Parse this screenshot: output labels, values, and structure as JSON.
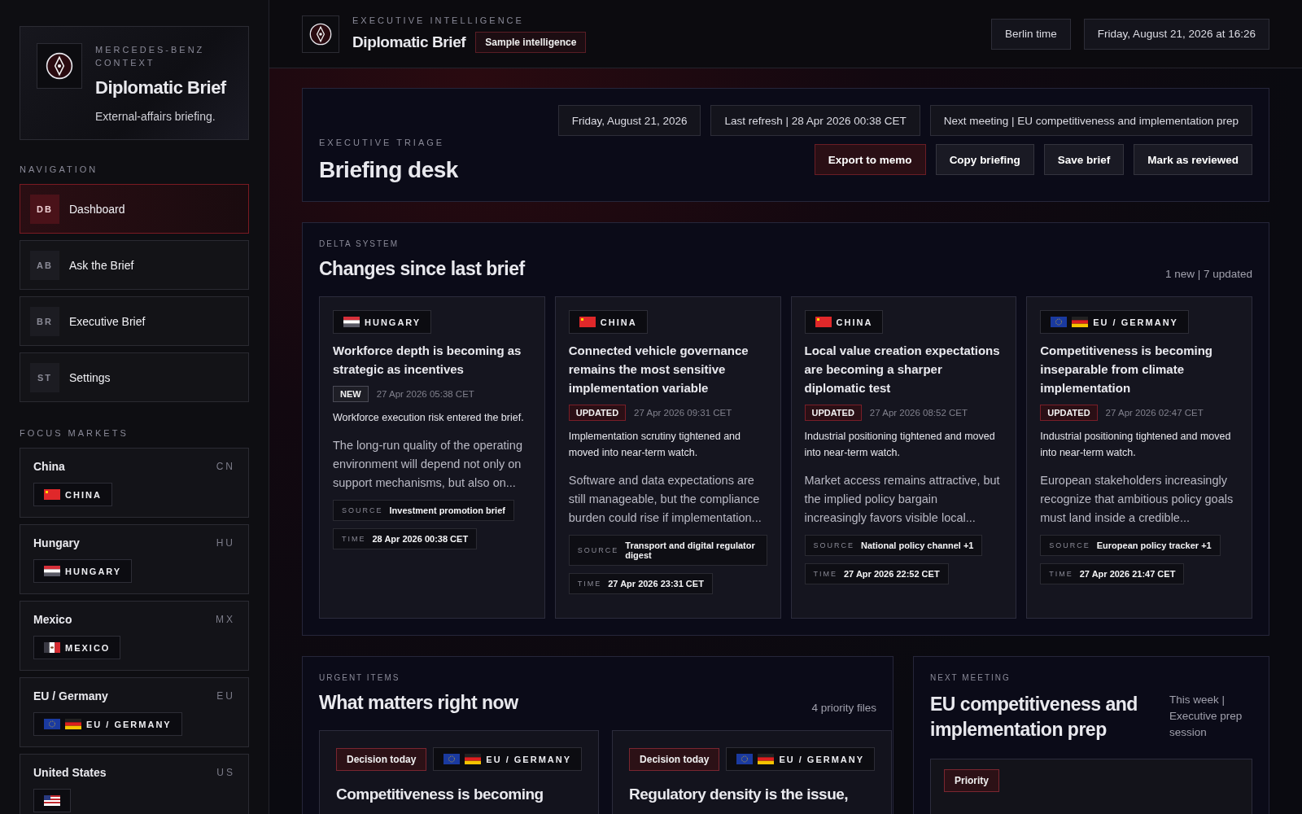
{
  "sidebar": {
    "brand": {
      "eyebrow": "MERCEDES-BENZ CONTEXT",
      "title": "Diplomatic Brief",
      "subtitle": "External-affairs briefing."
    },
    "navigation_label": "NAVIGATION",
    "nav_items": [
      {
        "code": "DB",
        "label": "Dashboard",
        "selected": true
      },
      {
        "code": "AB",
        "label": "Ask the Brief",
        "selected": false
      },
      {
        "code": "BR",
        "label": "Executive Brief",
        "selected": false
      },
      {
        "code": "ST",
        "label": "Settings",
        "selected": false
      }
    ],
    "markets_label": "FOCUS MARKETS",
    "markets": [
      {
        "name": "China",
        "code": "CN",
        "tag": {
          "label": "CHINA",
          "flags": [
            {
              "kind": "china"
            }
          ]
        }
      },
      {
        "name": "Hungary",
        "code": "HU",
        "tag": {
          "label": "HUNGARY",
          "flags": [
            {
              "kind": "hungary"
            }
          ]
        }
      },
      {
        "name": "Mexico",
        "code": "MX",
        "tag": {
          "label": "MEXICO",
          "flags": [
            {
              "kind": "mexico"
            }
          ]
        }
      },
      {
        "name": "EU / Germany",
        "code": "EU",
        "tag": {
          "label": "EU / GERMANY",
          "flags": [
            {
              "kind": "eu"
            },
            {
              "kind": "germany"
            }
          ]
        }
      },
      {
        "name": "United States",
        "code": "US",
        "tag": {
          "flags": [
            {
              "kind": "usa"
            }
          ]
        }
      }
    ]
  },
  "header": {
    "eyebrow": "EXECUTIVE INTELLIGENCE",
    "title": "Diplomatic Brief",
    "badge": "Sample intelligence",
    "chips": [
      "Berlin time",
      "Friday, August 21, 2026 at 16:26"
    ]
  },
  "triage": {
    "eyebrow": "EXECUTIVE TRIAGE",
    "title": "Briefing desk",
    "chips": [
      "Friday, August 21, 2026",
      "Last refresh | 28 Apr 2026 00:38 CET",
      "Next meeting | EU competitiveness and implementation prep"
    ],
    "actions": [
      {
        "label": "Export to memo",
        "kind": "primary"
      },
      {
        "label": "Copy briefing",
        "kind": "default"
      },
      {
        "label": "Save brief",
        "kind": "default"
      },
      {
        "label": "Mark as reviewed",
        "kind": "default"
      }
    ]
  },
  "delta": {
    "eyebrow": "DELTA SYSTEM",
    "title": "Changes since last brief",
    "count": "1 new | 7 updated",
    "cards": [
      {
        "tag": {
          "label": "HUNGARY",
          "flags": [
            {
              "kind": "hungary"
            }
          ]
        },
        "title": "Workforce depth is becoming as strategic as incentives",
        "status": {
          "label": "NEW",
          "kind": "new"
        },
        "time": "27 Apr 2026 05:38 CET",
        "summary": "Workforce execution risk entered the brief.",
        "body": "The long-run quality of the operating environment will depend not only on support mechanisms, but also on...",
        "source": {
          "label": "SOURCE",
          "value": "Investment promotion brief"
        },
        "stamp": {
          "label": "TIME",
          "value": "28 Apr 2026 00:38 CET"
        }
      },
      {
        "tag": {
          "label": "CHINA",
          "flags": [
            {
              "kind": "china"
            }
          ]
        },
        "title": "Connected vehicle governance remains the most sensitive implementation variable",
        "status": {
          "label": "UPDATED",
          "kind": "updated"
        },
        "time": "27 Apr 2026 09:31 CET",
        "summary": "Implementation scrutiny tightened and moved into near-term watch.",
        "body": "Software and data expectations are still manageable, but the compliance burden could rise if implementation...",
        "source": {
          "label": "SOURCE",
          "value": "Transport and digital regulator digest"
        },
        "stamp": {
          "label": "TIME",
          "value": "27 Apr 2026 23:31 CET"
        }
      },
      {
        "tag": {
          "label": "CHINA",
          "flags": [
            {
              "kind": "china"
            }
          ]
        },
        "title": "Local value creation expectations are becoming a sharper diplomatic test",
        "status": {
          "label": "UPDATED",
          "kind": "updated"
        },
        "time": "27 Apr 2026 08:52 CET",
        "summary": "Industrial positioning tightened and moved into near-term watch.",
        "body": "Market access remains attractive, but the implied policy bargain increasingly favors visible local...",
        "source": {
          "label": "SOURCE",
          "value": "National policy channel +1"
        },
        "stamp": {
          "label": "TIME",
          "value": "27 Apr 2026 22:52 CET"
        }
      },
      {
        "tag": {
          "label": "EU / GERMANY",
          "flags": [
            {
              "kind": "eu"
            },
            {
              "kind": "germany"
            }
          ]
        },
        "title": "Competitiveness is becoming inseparable from climate implementation",
        "status": {
          "label": "UPDATED",
          "kind": "updated"
        },
        "time": "27 Apr 2026 02:47 CET",
        "summary": "Industrial positioning tightened and moved into near-term watch.",
        "body": "European stakeholders increasingly recognize that ambitious policy goals must land inside a credible...",
        "source": {
          "label": "SOURCE",
          "value": "European policy tracker +1"
        },
        "stamp": {
          "label": "TIME",
          "value": "27 Apr 2026 21:47 CET"
        }
      }
    ]
  },
  "urgent": {
    "eyebrow": "URGENT ITEMS",
    "title": "What matters right now",
    "count": "4 priority files",
    "items": [
      {
        "badge": "Decision today",
        "tag": {
          "label": "EU / GERMANY",
          "flags": [
            {
              "kind": "eu"
            },
            {
              "kind": "germany"
            }
          ]
        },
        "title": "Competitiveness is becoming"
      },
      {
        "badge": "Decision today",
        "tag": {
          "label": "EU / GERMANY",
          "flags": [
            {
              "kind": "eu"
            },
            {
              "kind": "germany"
            }
          ]
        },
        "title": "Regulatory density is the issue,"
      }
    ]
  },
  "next_meeting": {
    "eyebrow": "NEXT MEETING",
    "title": "EU competitiveness and implementation prep",
    "note": "This week | Executive prep session",
    "badge": "Priority"
  }
}
